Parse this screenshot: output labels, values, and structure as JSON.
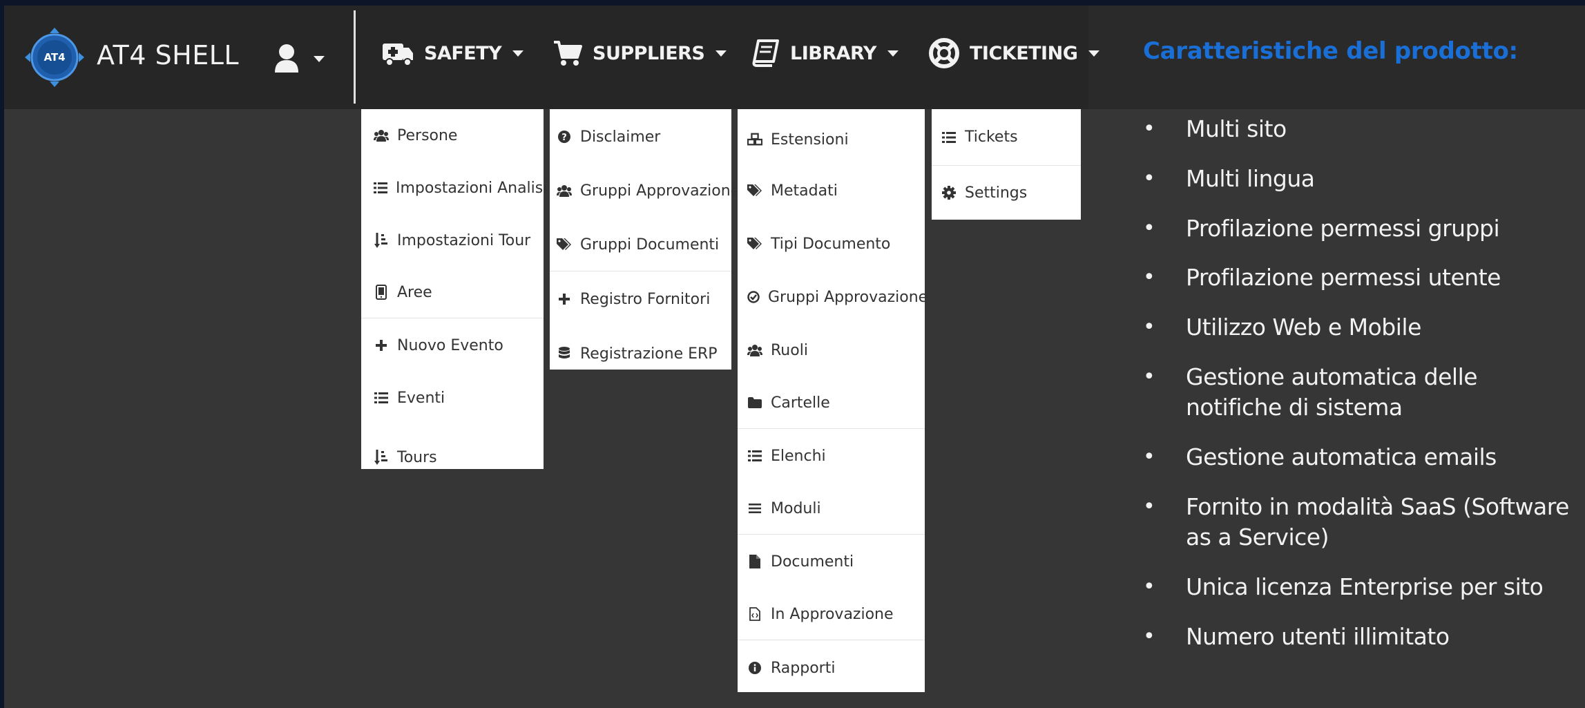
{
  "brand": {
    "name": "AT4 SHELL",
    "logo_text": "AT4"
  },
  "nav": [
    {
      "label": "SAFETY",
      "icon": "ambulance-icon"
    },
    {
      "label": "SUPPLIERS",
      "icon": "cart-icon"
    },
    {
      "label": "LIBRARY",
      "icon": "book-icon"
    },
    {
      "label": "TICKETING",
      "icon": "lifebuoy-icon"
    }
  ],
  "menus": {
    "safety": [
      "Persone",
      "Impostazioni Analisi",
      "Impostazioni Tour",
      "Aree",
      "Nuovo Evento",
      "Eventi",
      "Tours"
    ],
    "suppliers": [
      "Disclaimer",
      "Gruppi Approvazione",
      "Gruppi Documenti",
      "Registro Fornitori",
      "Registrazione ERP"
    ],
    "library": [
      "Estensioni",
      "Metadati",
      "Tipi Documento",
      "Gruppi Approvazione",
      "Ruoli",
      "Cartelle",
      "Elenchi",
      "Moduli",
      "Documenti",
      "In Approvazione",
      "Rapporti"
    ],
    "ticketing": [
      "Tickets",
      "Settings"
    ]
  },
  "features": {
    "title": "Caratteristiche del prodotto:",
    "items": [
      "Multi sito",
      "Multi lingua",
      "Profilazione permessi gruppi",
      "Profilazione permessi utente",
      "Utilizzo Web e Mobile",
      "Gestione automatica delle notifiche di sistema",
      "Gestione automatica emails",
      "Fornito in modalità SaaS (Software as a Service)",
      "Unica licenza Enterprise per sito",
      "Numero utenti illimitato"
    ]
  },
  "colors": {
    "navbar": "#262626",
    "background": "#363636",
    "accent": "#1a6fd6",
    "text": "#f2f2f2"
  }
}
